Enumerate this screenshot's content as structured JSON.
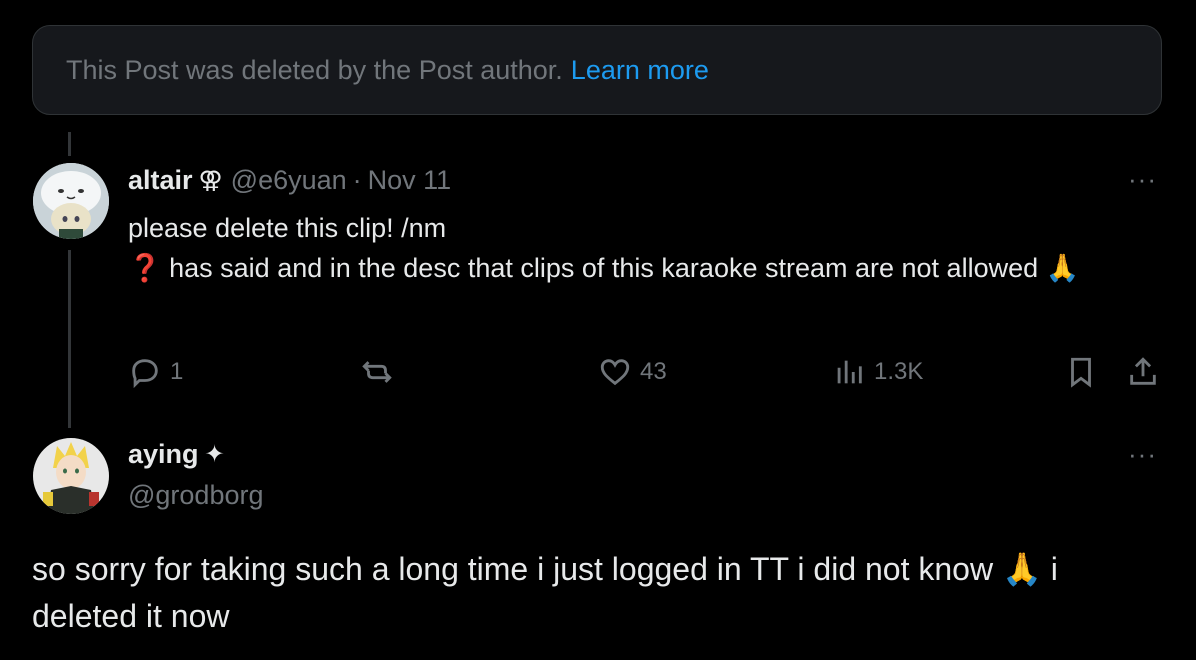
{
  "banner": {
    "text": "This Post was deleted by the Post author.",
    "link": "Learn more"
  },
  "tweet1": {
    "name": "altair",
    "badge_icon": "female-sign-icon",
    "handle": "@e6yuan",
    "separator": "·",
    "date": "Nov 11",
    "line1": "please delete this clip! /nm",
    "line2_emoji": "❓",
    "line2": " has said and in the desc that clips of this karaoke stream are not allowed",
    "line2_end_emoji": "🙏",
    "more": "···",
    "actions": {
      "reply_count": "1",
      "repost_count": "",
      "like_count": "43",
      "views_count": "1.3K"
    }
  },
  "tweet2": {
    "name": "aying",
    "badge": "✦",
    "handle": "@grodborg",
    "more": "···",
    "text_part1": "so sorry for taking such a long time i just logged in TT i did not know ",
    "text_emoji": "🙏",
    "text_part2": " i deleted it now"
  },
  "colors": {
    "background": "#000000",
    "text": "#e7e9ea",
    "muted": "#71767b",
    "link": "#1d9bf0",
    "border": "#2f3336"
  }
}
